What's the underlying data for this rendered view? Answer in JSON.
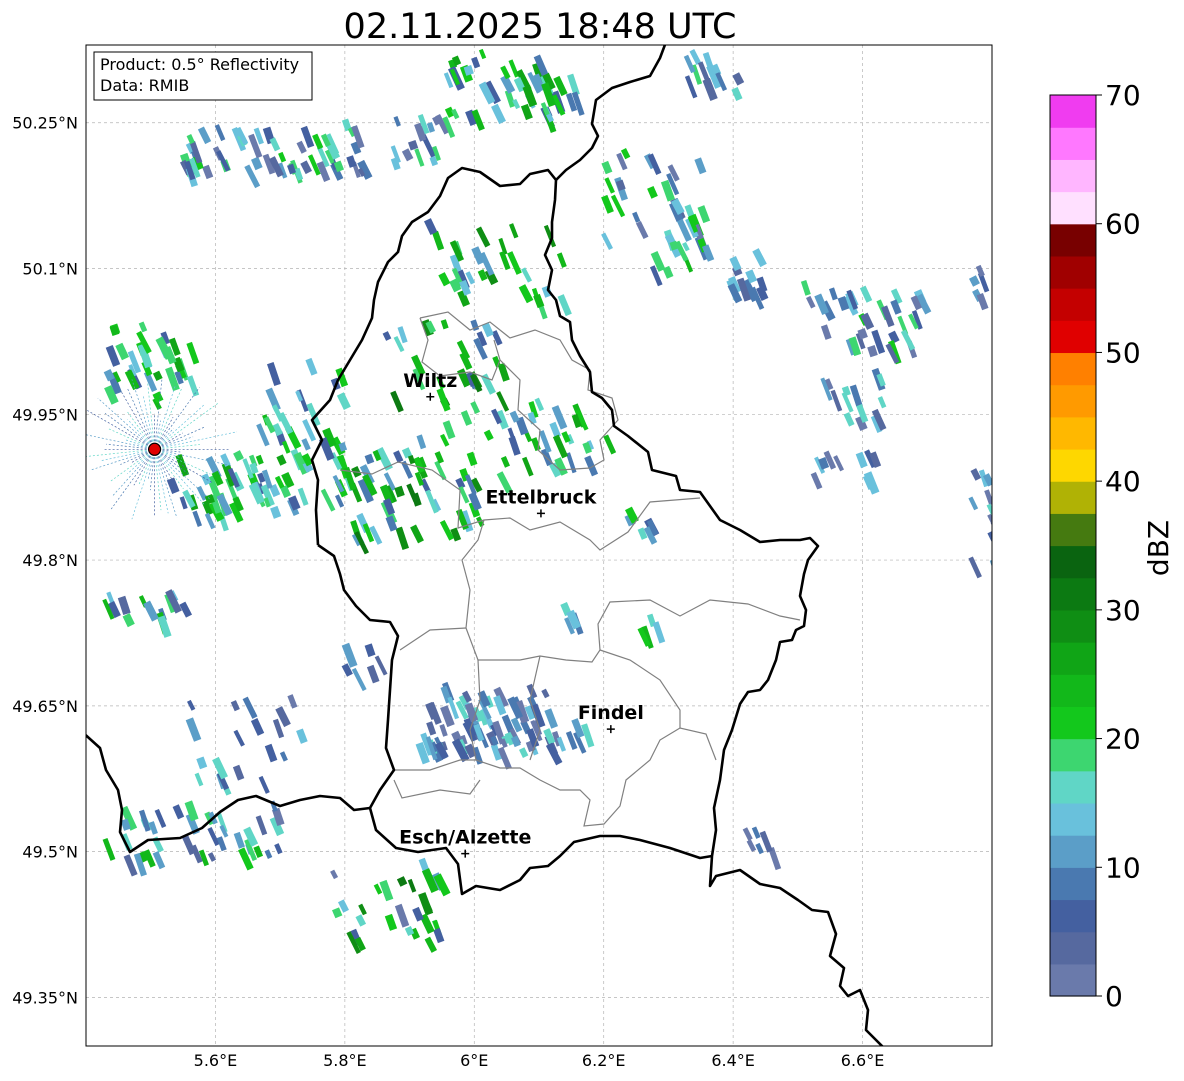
{
  "map": {
    "title": "02.11.2025 18:48 UTC",
    "info_box": {
      "product": "Product: 0.5° Reflectivity",
      "data": "Data: RMIB"
    },
    "lon_ticks": [
      {
        "value": 5.6,
        "label": "5.6°E"
      },
      {
        "value": 5.8,
        "label": "5.8°E"
      },
      {
        "value": 6.0,
        "label": "6°E"
      },
      {
        "value": 6.2,
        "label": "6.2°E"
      },
      {
        "value": 6.4,
        "label": "6.4°E"
      },
      {
        "value": 6.6,
        "label": "6.6°E"
      }
    ],
    "lat_ticks": [
      {
        "value": 50.25,
        "label": "50.25°N"
      },
      {
        "value": 50.1,
        "label": "50.1°N"
      },
      {
        "value": 49.95,
        "label": "49.95°N"
      },
      {
        "value": 49.8,
        "label": "49.8°N"
      },
      {
        "value": 49.65,
        "label": "49.65°N"
      },
      {
        "value": 49.5,
        "label": "49.5°N"
      },
      {
        "value": 49.35,
        "label": "49.35°N"
      }
    ],
    "cities": [
      {
        "name": "Wiltz",
        "lon": 5.932,
        "lat": 49.968
      },
      {
        "name": "Ettelbruck",
        "lon": 6.103,
        "lat": 49.848
      },
      {
        "name": "Findel",
        "lon": 6.211,
        "lat": 49.626
      },
      {
        "name": "Esch/Alzette",
        "lon": 5.986,
        "lat": 49.498
      }
    ],
    "radar_site": {
      "lon": 5.506,
      "lat": 49.914
    },
    "colorbar": {
      "label": "dBZ",
      "min": 0,
      "max": 70,
      "ticks": [
        0,
        10,
        20,
        30,
        40,
        50,
        60,
        70
      ],
      "tick_labels": [
        "0",
        "10",
        "20",
        "30",
        "40",
        "50",
        "60",
        "70"
      ],
      "colors": [
        "#6a7aab",
        "#56699f",
        "#4460a0",
        "#4a79b0",
        "#5b9ec8",
        "#69c1dc",
        "#60d6c6",
        "#3dd670",
        "#13c81c",
        "#12b81a",
        "#10a516",
        "#0f8e14",
        "#0c7a12",
        "#0a6410",
        "#457a10",
        "#b0b205",
        "#fed700",
        "#ffb800",
        "#ff9a00",
        "#ff8000",
        "#e00000",
        "#c40000",
        "#a00000",
        "#780000",
        "#ffe0ff",
        "#ffb6ff",
        "#ff78ff",
        "#f03cf0"
      ]
    },
    "colors": {
      "border": "#000000",
      "canton_lines": "#808080",
      "grid": "#b4b4b4",
      "radar_site": "#e00000"
    }
  }
}
